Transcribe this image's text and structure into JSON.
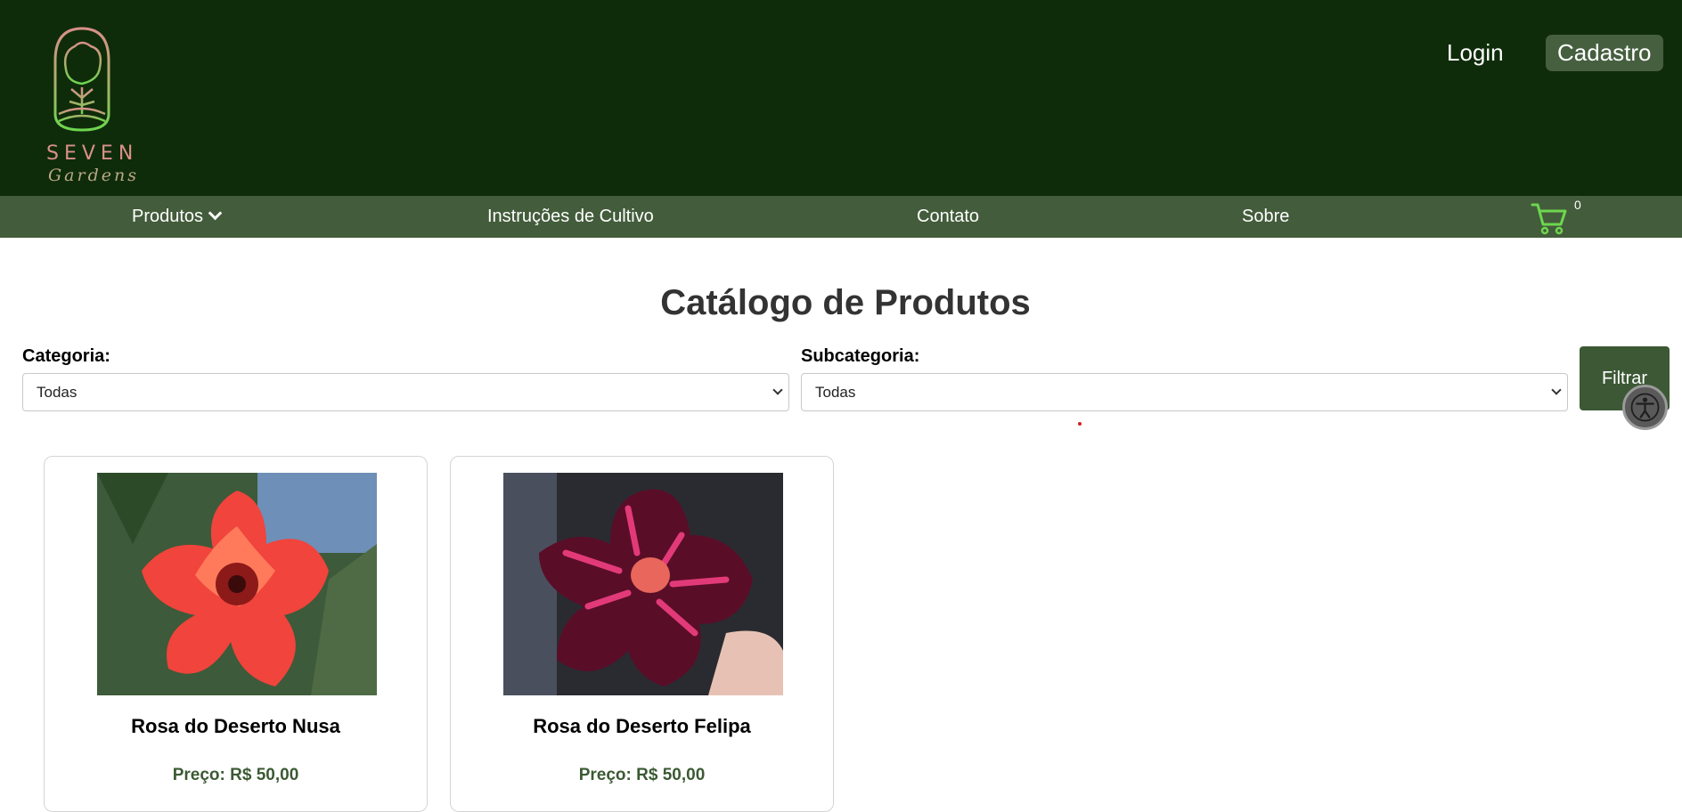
{
  "header": {
    "logo_brand": "SEVEN",
    "logo_sub": "Gardens",
    "login_label": "Login",
    "register_label": "Cadastro"
  },
  "nav": {
    "products_label": "Produtos",
    "instructions_label": "Instruções de Cultivo",
    "contact_label": "Contato",
    "about_label": "Sobre",
    "cart_count": "0"
  },
  "catalog": {
    "title": "Catálogo de Produtos",
    "category_label": "Categoria:",
    "category_value": "Todas",
    "subcategory_label": "Subcategoria:",
    "subcategory_value": "Todas",
    "filter_label": "Filtrar"
  },
  "products": [
    {
      "name": "Rosa do Deserto Nusa",
      "price": "Preço: R$ 50,00"
    },
    {
      "name": "Rosa do Deserto Felipa",
      "price": "Preço: R$ 50,00"
    }
  ],
  "colors": {
    "header_bg": "#0f2c0a",
    "nav_bg": "#435c3b",
    "accent": "#3c5835",
    "cart_icon": "#6dd64f"
  },
  "icons": [
    "tree-logo-icon",
    "chevron-down-icon",
    "cart-icon",
    "accessibility-icon"
  ]
}
